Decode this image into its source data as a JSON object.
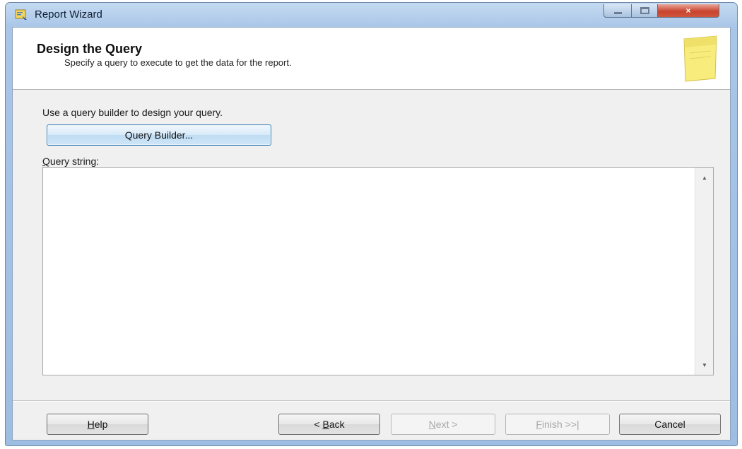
{
  "window": {
    "title": "Report Wizard",
    "icon": "report-wizard-icon",
    "controls": {
      "minimize": "minimize-icon",
      "maximize": "maximize-icon",
      "close": "×"
    }
  },
  "header": {
    "title": "Design the Query",
    "subtitle": "Specify a query to execute to get the data for the report.",
    "icon": "sticky-note-icon"
  },
  "main": {
    "instruction": "Use a query builder to design your query.",
    "query_builder_label": "Query Builder...",
    "query_string_label_mnemonic": "Q",
    "query_string_label_rest": "uery string:",
    "query_string_value": "",
    "scroll_up": "▲",
    "scroll_down": "▼"
  },
  "footer": {
    "help_mnemonic": "H",
    "help_rest": "elp",
    "back_prefix": "< ",
    "back_mnemonic": "B",
    "back_rest": "ack",
    "next_mnemonic": "N",
    "next_rest": "ext >",
    "finish_mnemonic": "F",
    "finish_rest": "inish >>|",
    "cancel_label": "Cancel"
  },
  "colors": {
    "titlebar": "#a9c6e8",
    "dialog_background": "#f0f0f0",
    "header_background": "#ffffff",
    "accent_button_border": "#3c7fb1",
    "close_button": "#c8452f",
    "disabled_text": "#a7a7a7"
  }
}
